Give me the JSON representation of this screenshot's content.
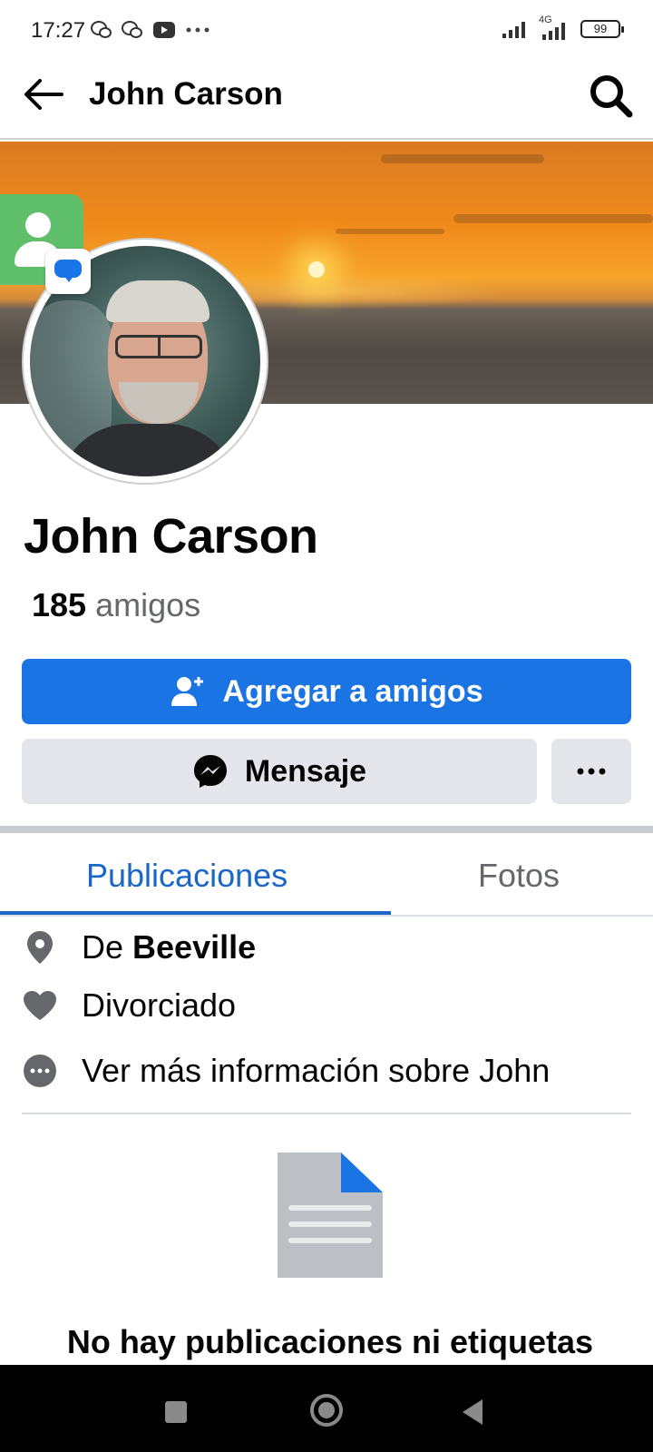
{
  "status_bar": {
    "time": "17:27",
    "notification_icons": [
      "wechat-icon",
      "wechat-icon",
      "youtube-icon",
      "more-icon"
    ],
    "network": "4G",
    "battery": "99"
  },
  "app_bar": {
    "title": "John Carson"
  },
  "profile": {
    "name": "John Carson",
    "friends_count": "185",
    "friends_label": "amigos"
  },
  "actions": {
    "add_friend_label": "Agregar a amigos",
    "message_label": "Mensaje"
  },
  "tabs": [
    {
      "label": "Publicaciones",
      "active": true
    },
    {
      "label": "Fotos",
      "active": false
    }
  ],
  "intro": {
    "hometown_prefix": "De",
    "hometown_value": "Beeville",
    "relationship": "Divorciado",
    "more_info": "Ver más información sobre John"
  },
  "empty_state": {
    "title": "No hay publicaciones ni etiquetas"
  },
  "colors": {
    "primary": "#1b74e4",
    "tab_active": "#1b66c9",
    "secondary_button": "#e4e6eb",
    "muted_text": "#65676b"
  }
}
